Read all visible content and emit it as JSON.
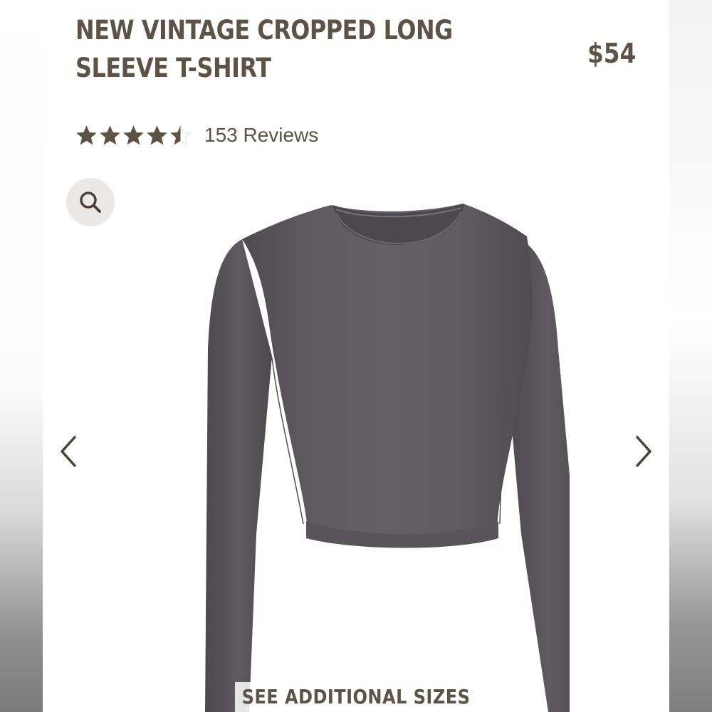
{
  "product": {
    "title": "NEW VINTAGE CROPPED LONG SLEEVE T-SHIRT",
    "price": "$54",
    "rating": 4.5,
    "reviews_label": "153 Reviews",
    "image_alt": "charcoal gray cropped long sleeve t-shirt"
  },
  "gallery": {
    "zoom_icon": "search-icon",
    "prev_icon": "chevron-left-icon",
    "next_icon": "chevron-right-icon"
  },
  "actions": {
    "see_sizes_label": "SEE ADDITIONAL SIZES"
  },
  "colors": {
    "text": "#5d5246",
    "shirt": "#5e5a60",
    "zoom_bg": "#ebe9e7"
  }
}
